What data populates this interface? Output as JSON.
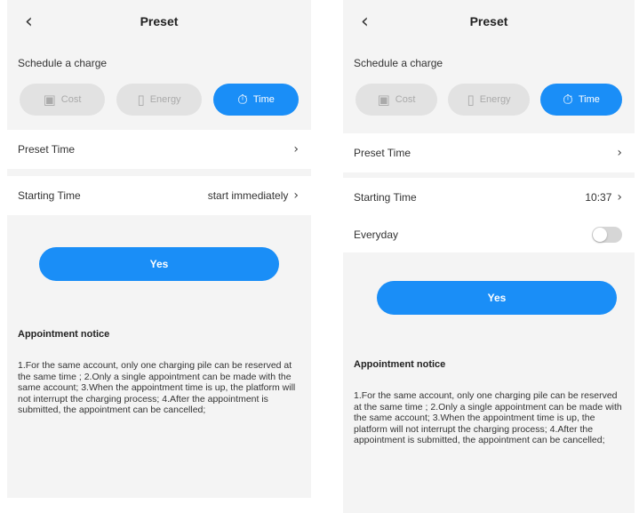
{
  "colors": {
    "accent": "#1a8ef7",
    "background": "#f4f4f4",
    "inactive_pill": "#e2e2e2"
  },
  "left": {
    "back_icon": "chevron-left-icon",
    "title": "Preset",
    "section_label": "Schedule a charge",
    "modes": [
      {
        "icon": "wallet-icon",
        "label": "Cost",
        "active": false
      },
      {
        "icon": "battery-icon",
        "label": "Energy",
        "active": false
      },
      {
        "icon": "timer-icon",
        "label": "Time",
        "active": true
      }
    ],
    "preset_time_label": "Preset Time",
    "starting_time_label": "Starting Time",
    "starting_time_value": "start immediately",
    "yes_label": "Yes",
    "notice_title": "Appointment notice",
    "notice_text": "1.For the same account, only one charging pile can be reserved at the same time ; 2.Only a single appointment can be made with the same account; 3.When the appointment time is up, the platform will not interrupt the charging process; 4.After the appointment is submitted, the appointment can be cancelled;"
  },
  "right": {
    "back_icon": "chevron-left-icon",
    "title": "Preset",
    "section_label": "Schedule a charge",
    "modes": [
      {
        "icon": "wallet-icon",
        "label": "Cost",
        "active": false
      },
      {
        "icon": "battery-icon",
        "label": "Energy",
        "active": false
      },
      {
        "icon": "timer-icon",
        "label": "Time",
        "active": true
      }
    ],
    "preset_time_label": "Preset Time",
    "starting_time_label": "Starting Time",
    "starting_time_value": "10:37",
    "everyday_label": "Everyday",
    "everyday_enabled": false,
    "yes_label": "Yes",
    "notice_title": "Appointment notice",
    "notice_text": "1.For the same account, only one charging pile can be reserved at the same time ; 2.Only a single appointment can be made with the same account; 3.When the appointment time is up, the platform will not interrupt the charging process; 4.After the appointment is submitted, the appointment can be cancelled;"
  }
}
